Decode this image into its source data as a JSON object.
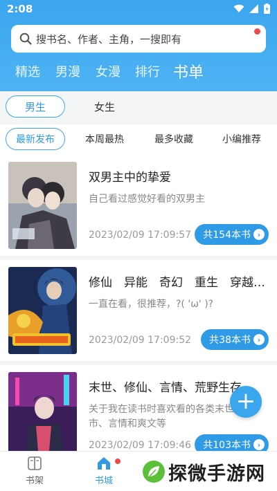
{
  "status_bar": {
    "time": "2:08"
  },
  "search": {
    "placeholder": "搜书名、作者、主角，一搜即有"
  },
  "top_tabs": [
    {
      "label": "精选"
    },
    {
      "label": "男漫"
    },
    {
      "label": "女漫"
    },
    {
      "label": "排行"
    },
    {
      "label": "书单",
      "active": true
    }
  ],
  "gender_tabs": [
    {
      "label": "男生",
      "active": true
    },
    {
      "label": "女生"
    }
  ],
  "sort_tabs": [
    {
      "label": "最新发布",
      "active": true
    },
    {
      "label": "本周最热"
    },
    {
      "label": "最多收藏"
    },
    {
      "label": "小编推荐"
    }
  ],
  "booklists": [
    {
      "title": "双男主中的挚爱",
      "description": "自己看过感觉好看的双男主",
      "date": "2023/02/09 17:09:57",
      "count_label": "共154本书"
    },
    {
      "title": "修仙　异能　奇幻　重生　穿越…",
      "description": "一直在看，很推荐，?( 'ω' )?",
      "date": "2023/02/09 17:09:52",
      "count_label": "共38本书"
    },
    {
      "title": "末世、修仙、言情、荒野生存…",
      "description": "关于我在读书时喜欢看的各类末世、都市、言情和爽文等",
      "date": "2023/02/09 17:09:46",
      "count_label": "共103本书"
    }
  ],
  "bottom_nav": [
    {
      "label": "书架",
      "icon": "bookshelf-icon"
    },
    {
      "label": "书城",
      "icon": "bookstore-icon",
      "active": true
    }
  ],
  "watermark": {
    "text": "探微手游网"
  },
  "colors": {
    "primary": "#3aa6ee",
    "accent_red": "#ef4a4a",
    "button_blue": "#2f9ae6"
  }
}
